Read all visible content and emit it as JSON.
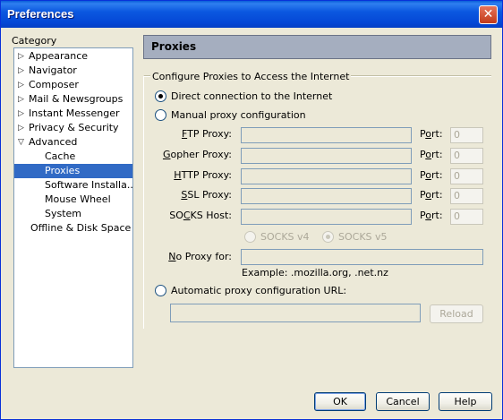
{
  "window": {
    "title": "Preferences"
  },
  "category": {
    "label": "Category",
    "items": [
      {
        "label": "Appearance",
        "expandable": true
      },
      {
        "label": "Navigator",
        "expandable": true
      },
      {
        "label": "Composer",
        "expandable": true
      },
      {
        "label": "Mail & Newsgroups",
        "expandable": true
      },
      {
        "label": "Instant Messenger",
        "expandable": true
      },
      {
        "label": "Privacy & Security",
        "expandable": true
      },
      {
        "label": "Advanced",
        "expanded": true
      },
      {
        "label": "Cache"
      },
      {
        "label": "Proxies",
        "selected": true
      },
      {
        "label": "Software Installa..."
      },
      {
        "label": "Mouse Wheel"
      },
      {
        "label": "System"
      },
      {
        "label": "Offline & Disk Space"
      }
    ]
  },
  "panel": {
    "title": "Proxies",
    "group_label": "Configure Proxies to Access the Internet",
    "direct": "Direct connection to the Internet",
    "manual": "Manual proxy configuration",
    "ftp_a": "F",
    "ftp_b": "TP Proxy:",
    "gopher_a": "G",
    "gopher_b": "opher Proxy:",
    "http_a": "H",
    "http_b": "TTP Proxy:",
    "ssl_a": "S",
    "ssl_b": "SL Proxy:",
    "socks_a": "SO",
    "socks_u": "C",
    "socks_b": "KS Host:",
    "port_a": "P",
    "port_u": "o",
    "port_b": "rt:",
    "port_placeholder": "0",
    "socks_v4": "SOCKS v4",
    "socks_v5": "SOCKS v5",
    "noproxy_u": "N",
    "noproxy_b": "o Proxy for:",
    "example": "Example: .mozilla.org, .net.nz",
    "auto": "Automatic proxy configuration URL:",
    "reload": "Reload"
  },
  "buttons": {
    "ok": "OK",
    "cancel": "Cancel",
    "help": "Help"
  }
}
